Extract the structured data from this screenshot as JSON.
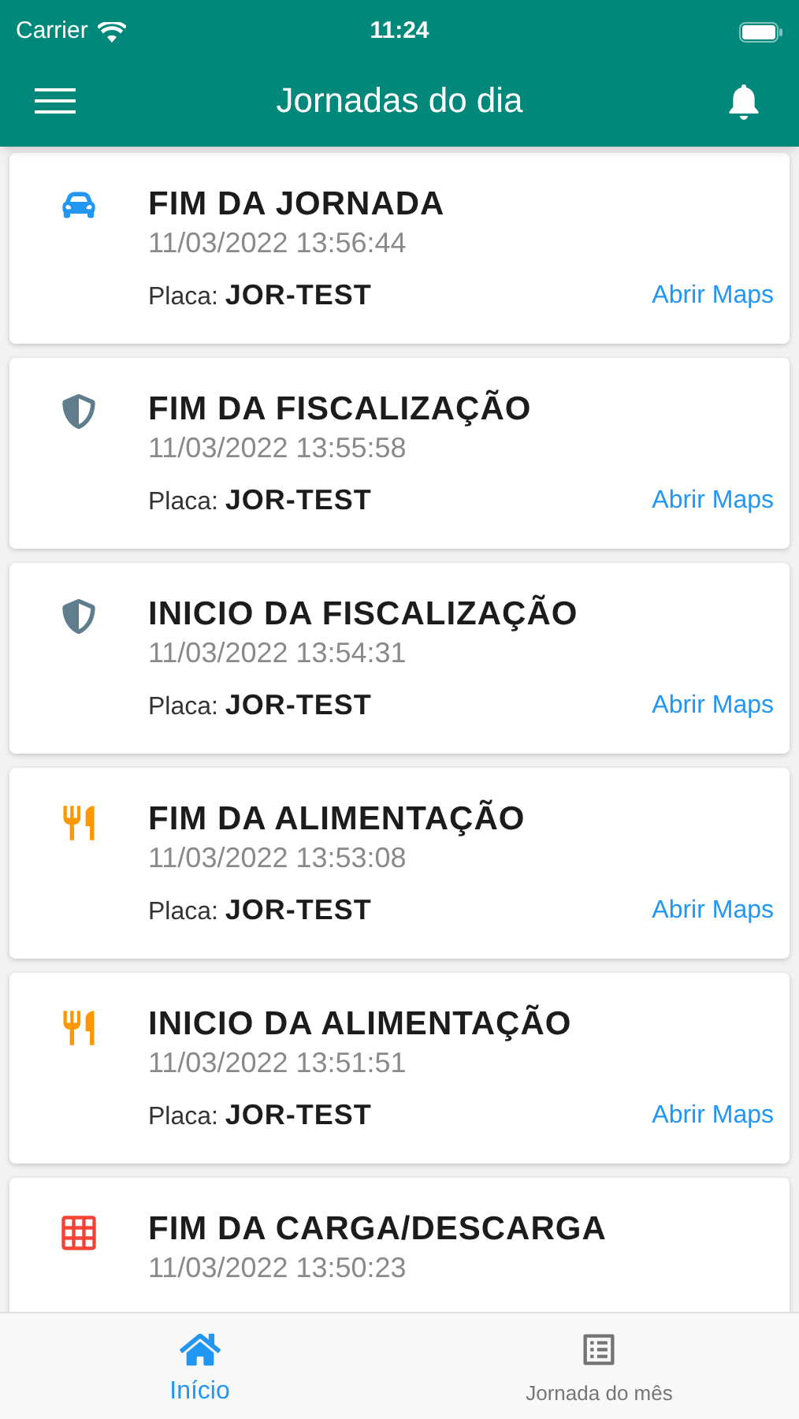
{
  "status_bar": {
    "carrier": "Carrier",
    "time": "11:24"
  },
  "header": {
    "title": "Jornadas do dia"
  },
  "events": [
    {
      "kind": "car",
      "title": "FIM DA JORNADA",
      "datetime": "11/03/2022 13:56:44",
      "plate_label": "Placa:",
      "plate": "JOR-TEST",
      "link": "Abrir Maps"
    },
    {
      "kind": "shield",
      "title": "FIM DA FISCALIZAÇÃO",
      "datetime": "11/03/2022 13:55:58",
      "plate_label": "Placa:",
      "plate": "JOR-TEST",
      "link": "Abrir Maps"
    },
    {
      "kind": "shield",
      "title": "INICIO DA FISCALIZAÇÃO",
      "datetime": "11/03/2022 13:54:31",
      "plate_label": "Placa:",
      "plate": "JOR-TEST",
      "link": "Abrir Maps"
    },
    {
      "kind": "food",
      "title": "FIM DA ALIMENTAÇÃO",
      "datetime": "11/03/2022 13:53:08",
      "plate_label": "Placa:",
      "plate": "JOR-TEST",
      "link": "Abrir Maps"
    },
    {
      "kind": "food",
      "title": "INICIO DA ALIMENTAÇÃO",
      "datetime": "11/03/2022 13:51:51",
      "plate_label": "Placa:",
      "plate": "JOR-TEST",
      "link": "Abrir Maps"
    },
    {
      "kind": "grid",
      "title": "FIM DA CARGA/DESCARGA",
      "datetime": "11/03/2022 13:50:23"
    }
  ],
  "tab_bar": [
    {
      "kind": "home",
      "label": "Início",
      "selected": true
    },
    {
      "kind": "list",
      "label": "Jornada do mês",
      "selected": false
    }
  ]
}
